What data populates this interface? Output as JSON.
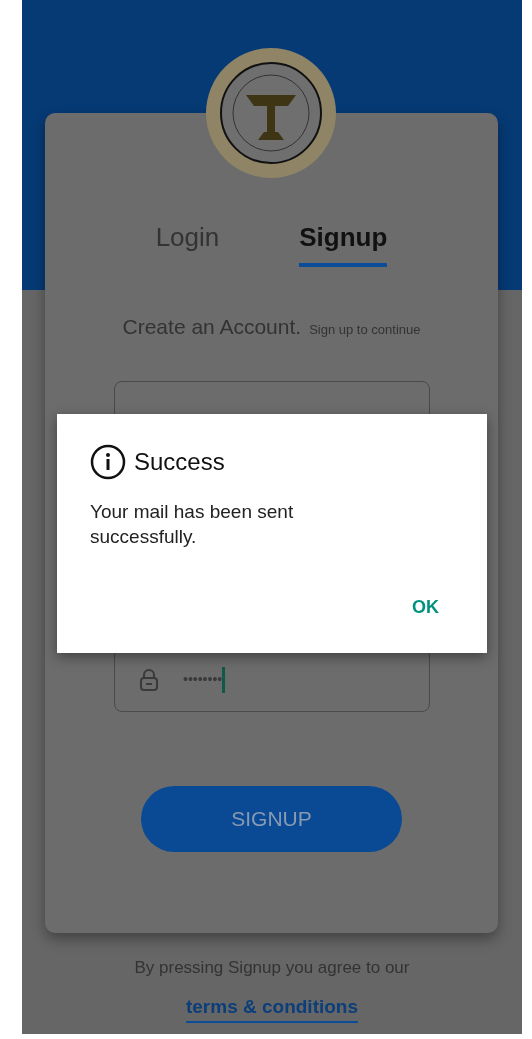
{
  "tabs": [
    {
      "label": "Login",
      "selected": false
    },
    {
      "label": "Signup",
      "selected": true
    }
  ],
  "heading": "Create an Account.",
  "subheading": "Sign up to continue",
  "fields": [
    {
      "kind": "blank"
    },
    {
      "kind": "password",
      "value": "••••••••",
      "focused": true
    }
  ],
  "signup_button": "SIGNUP",
  "footer": {
    "text": "By pressing Signup you agree to our",
    "link": "terms & conditions"
  },
  "dialog": {
    "title": "Success",
    "message": "Your mail has been sent successfully.",
    "button": "OK"
  }
}
